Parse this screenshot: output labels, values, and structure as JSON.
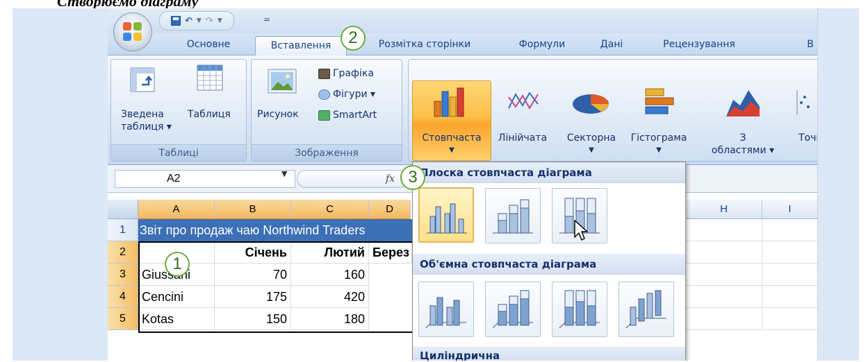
{
  "page_heading": "Створюємо діаграму",
  "qat": {
    "customize_glyph": "="
  },
  "tabs": [
    {
      "label": "Основне"
    },
    {
      "label": "Вставлення"
    },
    {
      "label": "Розмітка сторінки"
    },
    {
      "label": "Формули"
    },
    {
      "label": "Дані"
    },
    {
      "label": "Рецензування"
    },
    {
      "label": "В"
    }
  ],
  "ribbon": {
    "tables_group": {
      "label": "Таблиці",
      "pivot_line1": "Зведена",
      "pivot_line2": "таблиця ▾",
      "table": "Таблиця"
    },
    "illustrations_group": {
      "label": "Зображення",
      "picture": "Рисунок",
      "clipart": "Графіка",
      "shapes": "Фігури ▾",
      "smartart": "SmartArt"
    },
    "charts_group": {
      "column": "Стовпчаста",
      "line": "Лінійчата",
      "pie": "Секторна",
      "bar": "Гістограма",
      "area_line1": "З",
      "area_line2": "областями ▾",
      "scatter": "Точк"
    }
  },
  "formula_bar": {
    "name_box": "A2",
    "fx": "fx"
  },
  "sheet": {
    "columns": [
      "A",
      "B",
      "C",
      "D",
      "H",
      "I"
    ],
    "rows": [
      "1",
      "2",
      "3",
      "4",
      "5"
    ],
    "title": "Звіт про продаж чаю Northwind Traders",
    "headers": [
      "Січень",
      "Лютий",
      "Берез"
    ],
    "data": [
      {
        "name": "Giussani",
        "b": "70",
        "c": "160"
      },
      {
        "name": "Cencini",
        "b": "175",
        "c": "420"
      },
      {
        "name": "Kotas",
        "b": "150",
        "c": "180"
      }
    ]
  },
  "gallery": {
    "flat_header": "Плоска стовпчаста діаграма",
    "three_d_header": "Об'ємна стовпчаста діаграма",
    "cylinder_header": "Циліндрична"
  },
  "callouts": [
    "1",
    "2",
    "3"
  ],
  "colors": {
    "accent": "#3d6fb6",
    "active_button": "#fcb944",
    "callout_ring": "#6cab3a",
    "ribbon_text": "#15306b"
  }
}
